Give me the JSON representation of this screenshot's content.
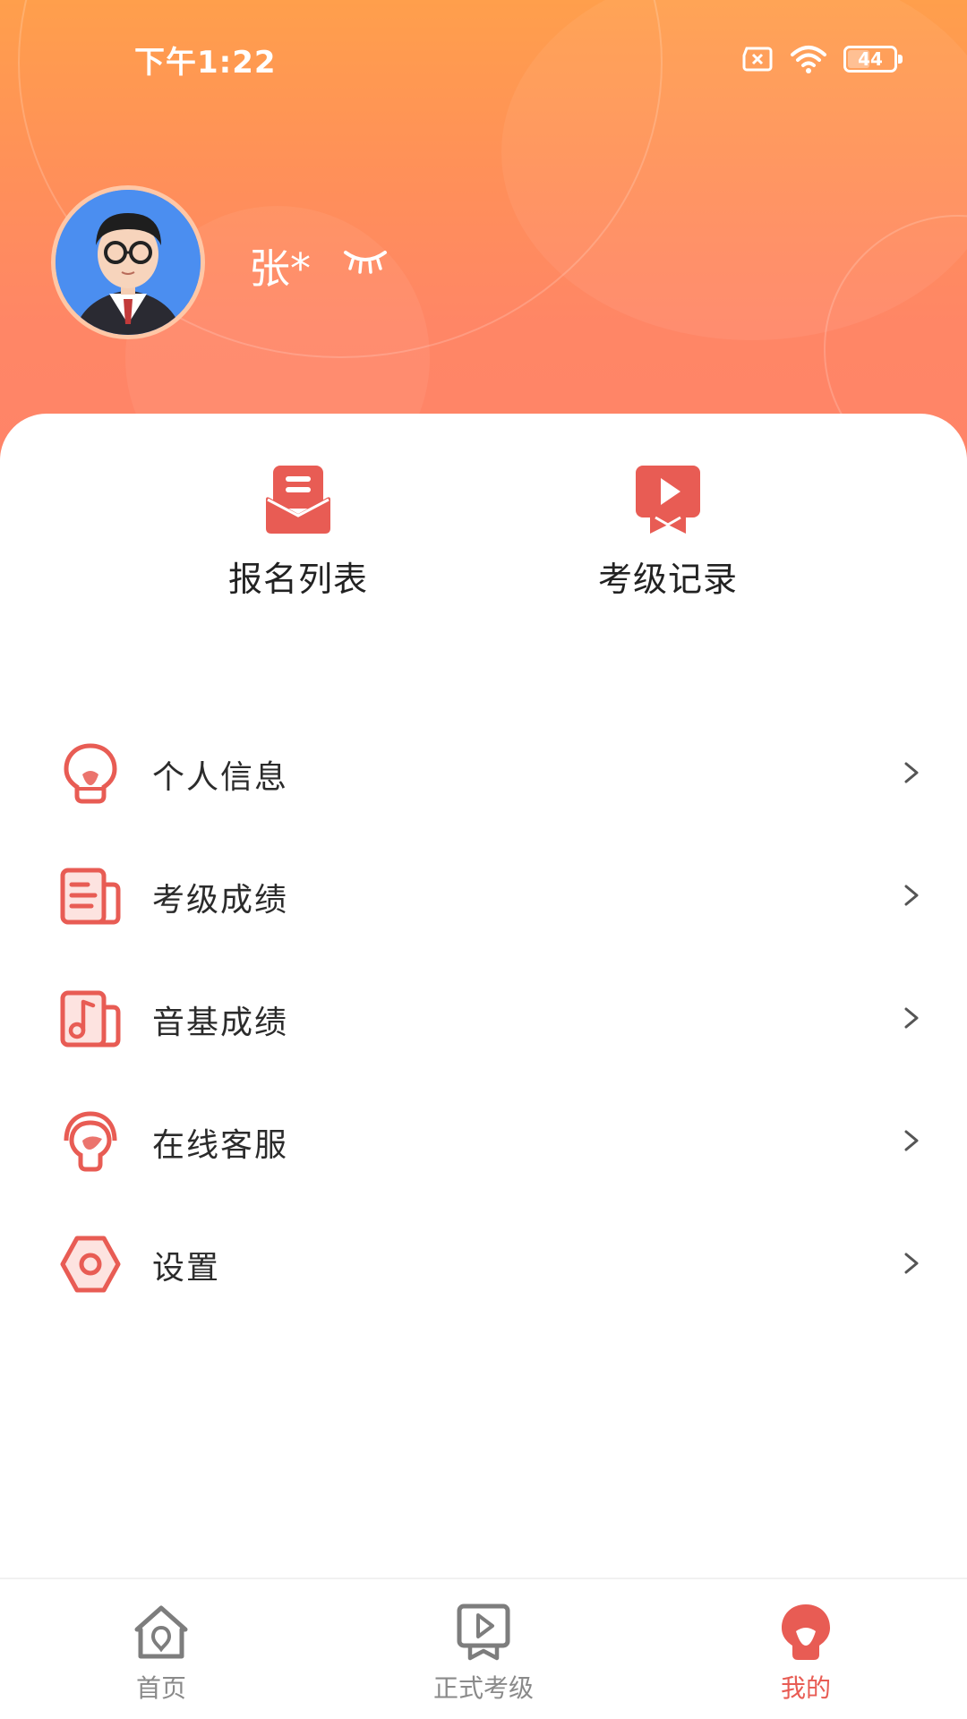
{
  "status_bar": {
    "time": "下午1:22",
    "battery": "44"
  },
  "profile": {
    "name": "张*"
  },
  "quick_actions": [
    {
      "label": "报名列表",
      "icon": "envelope-list-icon"
    },
    {
      "label": "考级记录",
      "icon": "play-ribbon-icon"
    }
  ],
  "menu": [
    {
      "label": "个人信息",
      "icon": "person-bulb-icon"
    },
    {
      "label": "考级成绩",
      "icon": "document-icon"
    },
    {
      "label": "音基成绩",
      "icon": "music-note-icon"
    },
    {
      "label": "在线客服",
      "icon": "headset-icon"
    },
    {
      "label": "设置",
      "icon": "settings-hex-icon"
    }
  ],
  "nav": [
    {
      "label": "首页",
      "icon": "home-icon",
      "active": false
    },
    {
      "label": "正式考级",
      "icon": "exam-play-icon",
      "active": false
    },
    {
      "label": "我的",
      "icon": "profile-icon",
      "active": true
    }
  ],
  "colors": {
    "accent": "#e85c54",
    "header_top": "#ff9f4c",
    "header_bottom": "#ff8468"
  }
}
